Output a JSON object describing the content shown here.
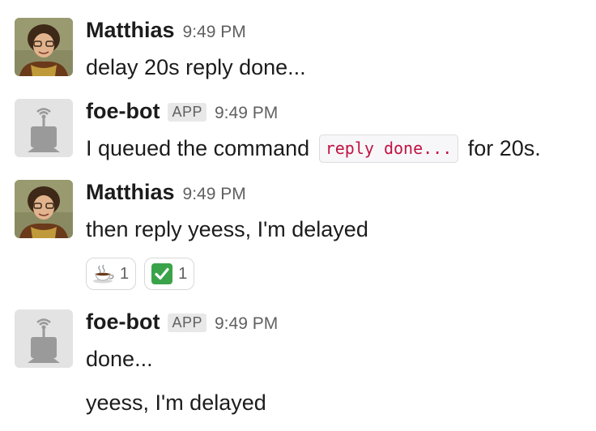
{
  "messages": [
    {
      "author": "Matthias",
      "time": "9:49 PM",
      "text": "delay 20s reply done..."
    },
    {
      "author": "foe-bot",
      "badge": "APP",
      "time": "9:49 PM",
      "text_before": "I queued the command",
      "code": "reply done...",
      "text_after": "for 20s."
    },
    {
      "author": "Matthias",
      "time": "9:49 PM",
      "text": "then reply yeess, I'm delayed",
      "reactions": [
        {
          "emoji": "coffee-icon",
          "count": "1"
        },
        {
          "emoji": "white-check-mark-icon",
          "count": "1"
        }
      ]
    },
    {
      "author": "foe-bot",
      "badge": "APP",
      "time": "9:49 PM",
      "text": "done...",
      "followup": "yeess, I'm delayed"
    }
  ],
  "colors": {
    "code_text": "#c01343",
    "check_green": "#3aa34a",
    "bot_avatar_bg": "#e3e3e3",
    "bot_avatar_fg": "#9a9a9a"
  }
}
